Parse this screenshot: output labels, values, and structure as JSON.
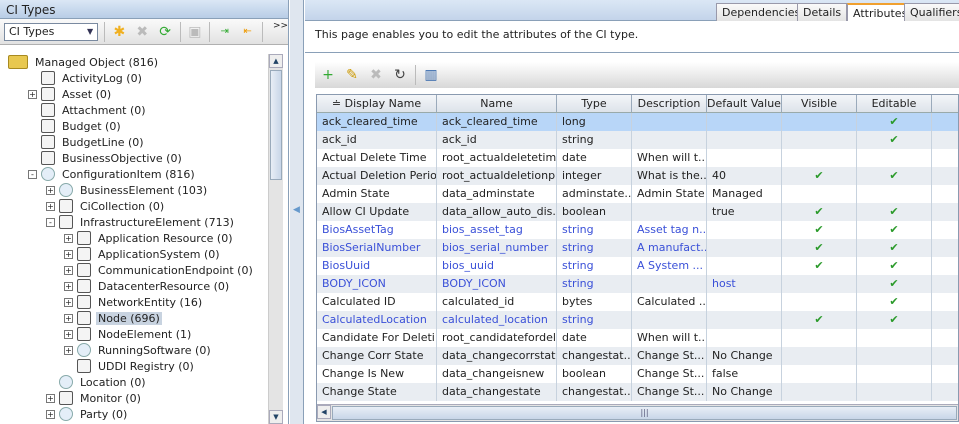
{
  "left": {
    "title": "CI Types",
    "combo_value": "CI Types",
    "overflow": ">>",
    "tree": [
      {
        "label": "Managed Object (816)",
        "depth": 0,
        "exp": "",
        "icon": "folder"
      },
      {
        "label": "ActivityLog (0)",
        "depth": 1,
        "exp": "",
        "icon": "box"
      },
      {
        "label": "Asset (0)",
        "depth": 1,
        "exp": "+",
        "icon": "box"
      },
      {
        "label": "Attachment (0)",
        "depth": 1,
        "exp": "",
        "icon": "box"
      },
      {
        "label": "Budget (0)",
        "depth": 1,
        "exp": "",
        "icon": "box"
      },
      {
        "label": "BudgetLine (0)",
        "depth": 1,
        "exp": "",
        "icon": "box"
      },
      {
        "label": "BusinessObjective (0)",
        "depth": 1,
        "exp": "",
        "icon": "box"
      },
      {
        "label": "ConfigurationItem (816)",
        "depth": 1,
        "exp": "-",
        "icon": "globe"
      },
      {
        "label": "BusinessElement (103)",
        "depth": 2,
        "exp": "+",
        "icon": "globe"
      },
      {
        "label": "CiCollection (0)",
        "depth": 2,
        "exp": "+",
        "icon": "box"
      },
      {
        "label": "InfrastructureElement (713)",
        "depth": 2,
        "exp": "-",
        "icon": "box"
      },
      {
        "label": "Application Resource (0)",
        "depth": 3,
        "exp": "+",
        "icon": "box"
      },
      {
        "label": "ApplicationSystem (0)",
        "depth": 3,
        "exp": "+",
        "icon": "box"
      },
      {
        "label": "CommunicationEndpoint (0)",
        "depth": 3,
        "exp": "+",
        "icon": "box"
      },
      {
        "label": "DatacenterResource (0)",
        "depth": 3,
        "exp": "+",
        "icon": "flag"
      },
      {
        "label": "NetworkEntity (16)",
        "depth": 3,
        "exp": "+",
        "icon": "box"
      },
      {
        "label": "Node (696)",
        "depth": 3,
        "exp": "+",
        "icon": "box",
        "selected": true
      },
      {
        "label": "NodeElement (1)",
        "depth": 3,
        "exp": "+",
        "icon": "box"
      },
      {
        "label": "RunningSoftware (0)",
        "depth": 3,
        "exp": "+",
        "icon": "globe"
      },
      {
        "label": "UDDI Registry (0)",
        "depth": 3,
        "exp": "",
        "icon": "box"
      },
      {
        "label": "Location (0)",
        "depth": 2,
        "exp": "",
        "icon": "globe"
      },
      {
        "label": "Monitor (0)",
        "depth": 2,
        "exp": "+",
        "icon": "box"
      },
      {
        "label": "Party (0)",
        "depth": 2,
        "exp": "+",
        "icon": "globe"
      }
    ]
  },
  "right": {
    "tabs": [
      "Dependencies",
      "Details",
      "Attributes",
      "Qualifiers"
    ],
    "description": "This page enables you to edit the attributes of the CI type.",
    "columns": [
      "Display Name",
      "Name",
      "Type",
      "Description",
      "Default Value",
      "Visible",
      "Editable",
      ""
    ],
    "check": "✔",
    "rows": [
      [
        "ack_cleared_time",
        "ack_cleared_time",
        "long",
        "",
        "",
        "",
        true
      ],
      [
        "ack_id",
        "ack_id",
        "string",
        "",
        "",
        "",
        true
      ],
      [
        "Actual Delete Time",
        "root_actualdeletetime",
        "date",
        "When will t...",
        "",
        "",
        ""
      ],
      [
        "Actual Deletion Period",
        "root_actualdeletionp...",
        "integer",
        "What is the...",
        "40",
        true,
        true
      ],
      [
        "Admin State",
        "data_adminstate",
        "adminstate...",
        "Admin State",
        "Managed",
        "",
        ""
      ],
      [
        "Allow CI Update",
        "data_allow_auto_dis...",
        "boolean",
        "",
        "true",
        true,
        true
      ],
      [
        "BiosAssetTag",
        "bios_asset_tag",
        "string",
        "Asset tag n...",
        "",
        true,
        true
      ],
      [
        "BiosSerialNumber",
        "bios_serial_number",
        "string",
        "A manufact...",
        "",
        true,
        true
      ],
      [
        "BiosUuid",
        "bios_uuid",
        "string",
        "A System ...",
        "",
        true,
        true
      ],
      [
        "BODY_ICON",
        "BODY_ICON",
        "string",
        "",
        "host",
        "",
        true
      ],
      [
        "Calculated ID",
        "calculated_id",
        "bytes",
        "Calculated ...",
        "",
        "",
        true
      ],
      [
        "CalculatedLocation",
        "calculated_location",
        "string",
        "",
        "",
        true,
        true
      ],
      [
        "Candidate For Deleti...",
        "root_candidatefordel...",
        "date",
        "When will t...",
        "",
        "",
        ""
      ],
      [
        "Change Corr State",
        "data_changecorrstate",
        "changestat...",
        "Change St...",
        "No Change",
        "",
        ""
      ],
      [
        "Change Is New",
        "data_changeisnew",
        "boolean",
        "Change St...",
        "false",
        "",
        ""
      ],
      [
        "Change State",
        "data_changestate",
        "changestat...",
        "Change St...",
        "No Change",
        "",
        ""
      ]
    ],
    "blue_rows": [
      6,
      7,
      8,
      9,
      11
    ]
  }
}
